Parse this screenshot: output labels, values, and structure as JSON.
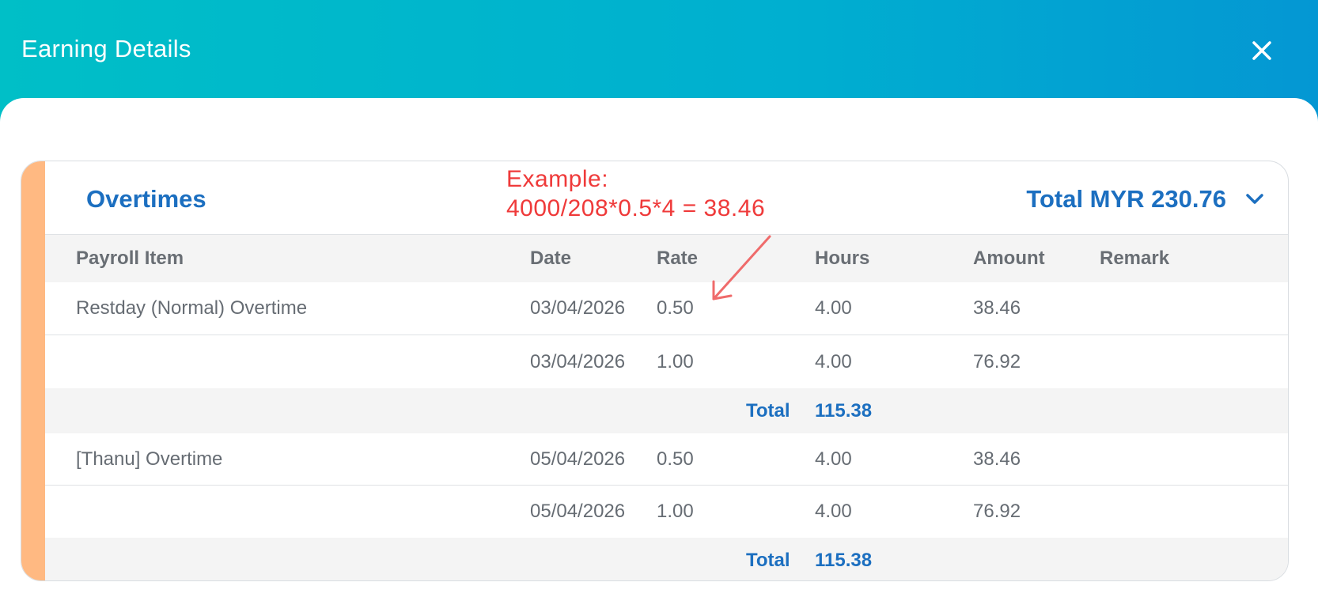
{
  "header": {
    "title": "Earning Details"
  },
  "section": {
    "title": "Overtimes",
    "total": "Total MYR 230.76"
  },
  "annotation": {
    "line1": "Example:",
    "line2": "4000/208*0.5*4 = 38.46"
  },
  "columns": {
    "payroll_item": "Payroll Item",
    "date": "Date",
    "rate": "Rate",
    "hours": "Hours",
    "amount": "Amount",
    "remark": "Remark"
  },
  "rows": [
    {
      "item": "Restday (Normal) Overtime",
      "date": "03/04/2026",
      "rate": "0.50",
      "hours": "4.00",
      "amount": "38.46",
      "remark": ""
    },
    {
      "item": "",
      "date": "03/04/2026",
      "rate": "1.00",
      "hours": "4.00",
      "amount": "76.92",
      "remark": ""
    },
    {
      "total_label": "Total",
      "total_value": "115.38"
    },
    {
      "item": "[Thanu] Overtime",
      "date": "05/04/2026",
      "rate": "0.50",
      "hours": "4.00",
      "amount": "38.46",
      "remark": ""
    },
    {
      "item": "",
      "date": "05/04/2026",
      "rate": "1.00",
      "hours": "4.00",
      "amount": "76.92",
      "remark": ""
    },
    {
      "total_label": "Total",
      "total_value": "115.38"
    }
  ],
  "colors": {
    "gradient_start": "#00bfc7",
    "gradient_end": "#0497d3",
    "accent_bar": "#ffb982",
    "primary_text": "#1c6fc0",
    "annotation": "#ef3a3a"
  },
  "icons": {
    "close": "close-icon",
    "expand": "chevron-down-icon",
    "annotation_arrow": "arrow-icon"
  }
}
